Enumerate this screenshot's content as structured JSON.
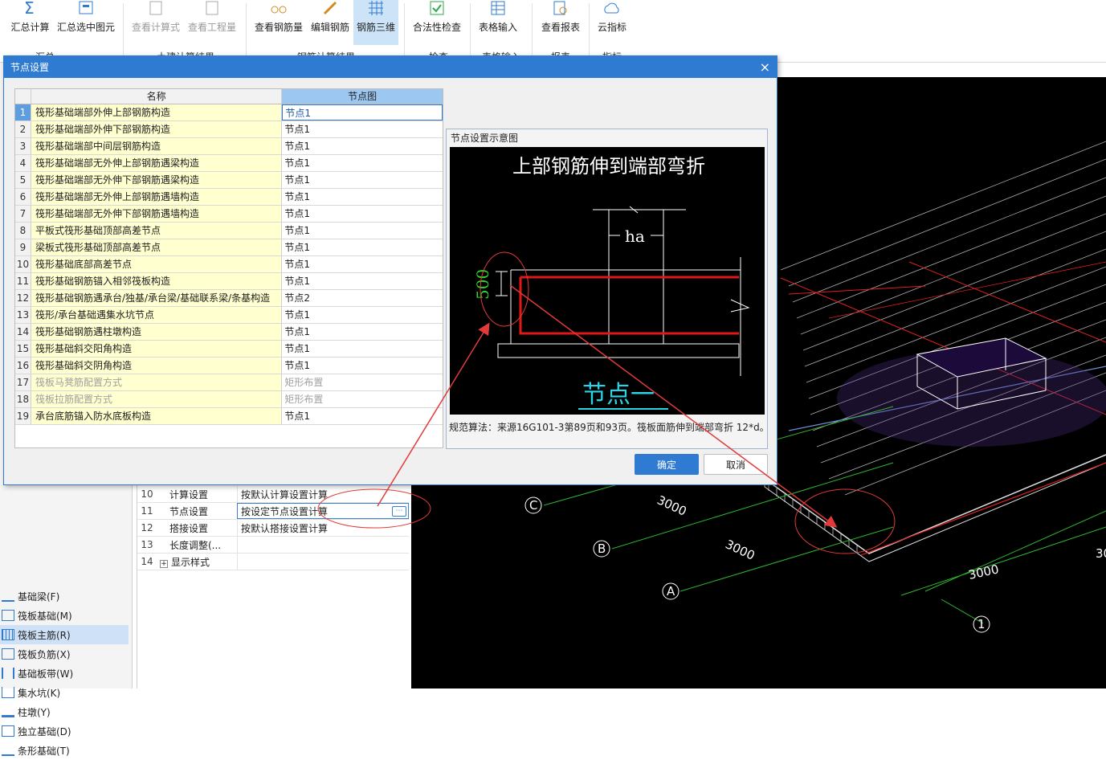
{
  "ribbon": {
    "buttons": [
      {
        "label": "汇总计算",
        "disabled": false
      },
      {
        "label": "汇总选中图元",
        "disabled": false
      },
      {
        "label": "查看计算式",
        "disabled": true
      },
      {
        "label": "查看工程量",
        "disabled": true
      },
      {
        "label": "查看钢筋量",
        "disabled": false
      },
      {
        "label": "编辑钢筋",
        "disabled": false
      },
      {
        "label": "钢筋三维",
        "disabled": false,
        "active": true
      },
      {
        "label": "合法性检查",
        "disabled": false
      },
      {
        "label": "表格输入",
        "disabled": false
      },
      {
        "label": "查看报表",
        "disabled": false
      },
      {
        "label": "云指标",
        "disabled": false
      }
    ],
    "groups": [
      "汇总",
      "土建计算结果",
      "钢筋计算结果",
      "检查",
      "表格输入",
      "报表",
      "指标"
    ]
  },
  "dialog": {
    "title": "节点设置",
    "close": "×",
    "col_name": "名称",
    "col_node": "节点图",
    "rows": [
      {
        "no": "1",
        "name": "筏形基础端部外伸上部钢筋构造",
        "node": "节点1",
        "selected": true
      },
      {
        "no": "2",
        "name": "筏形基础端部外伸下部钢筋构造",
        "node": "节点1"
      },
      {
        "no": "3",
        "name": "筏形基础端部中间层钢筋构造",
        "node": "节点1"
      },
      {
        "no": "4",
        "name": "筏形基础端部无外伸上部钢筋遇梁构造",
        "node": "节点1"
      },
      {
        "no": "5",
        "name": "筏形基础端部无外伸下部钢筋遇梁构造",
        "node": "节点1"
      },
      {
        "no": "6",
        "name": "筏形基础端部无外伸上部钢筋遇墙构造",
        "node": "节点1"
      },
      {
        "no": "7",
        "name": "筏形基础端部无外伸下部钢筋遇墙构造",
        "node": "节点1"
      },
      {
        "no": "8",
        "name": "平板式筏形基础顶部高差节点",
        "node": "节点1"
      },
      {
        "no": "9",
        "name": "梁板式筏形基础顶部高差节点",
        "node": "节点1"
      },
      {
        "no": "10",
        "name": "筏形基础底部高差节点",
        "node": "节点1"
      },
      {
        "no": "11",
        "name": "筏形基础钢筋锚入相邻筏板构造",
        "node": "节点1"
      },
      {
        "no": "12",
        "name": "筏形基础钢筋遇承台/独基/承台梁/基础联系梁/条基构造",
        "node": "节点2"
      },
      {
        "no": "13",
        "name": "筏形/承台基础遇集水坑节点",
        "node": "节点1"
      },
      {
        "no": "14",
        "name": "筏形基础钢筋遇柱墩构造",
        "node": "节点1"
      },
      {
        "no": "15",
        "name": "筏形基础斜交阳角构造",
        "node": "节点1"
      },
      {
        "no": "16",
        "name": "筏形基础斜交阴角构造",
        "node": "节点1"
      },
      {
        "no": "17",
        "name": "筏板马凳筋配置方式",
        "node": "矩形布置",
        "disabled": true
      },
      {
        "no": "18",
        "name": "筏板拉筋配置方式",
        "node": "矩形布置",
        "disabled": true
      },
      {
        "no": "19",
        "name": "承台底筋锚入防水底板构造",
        "node": "节点1"
      }
    ],
    "preview_title": "节点设置示意图",
    "diagram": {
      "heading": "上部钢筋伸到端部弯折",
      "ha": "ha",
      "dim": "500",
      "node_label": "节点一"
    },
    "preview_desc": "规范算法：来源16G101-3第89页和93页。筏板面筋伸到端部弯折 12*d。",
    "ok": "确定",
    "cancel": "取消"
  },
  "left_tree": [
    {
      "label": "基础梁(F)"
    },
    {
      "label": "筏板基础(M)"
    },
    {
      "label": "筏板主筋(R)",
      "selected": true
    },
    {
      "label": "筏板负筋(X)"
    },
    {
      "label": "基础板带(W)"
    },
    {
      "label": "集水坑(K)"
    },
    {
      "label": "柱墩(Y)"
    },
    {
      "label": "独立基础(D)"
    },
    {
      "label": "条形基础(T)"
    }
  ],
  "props": [
    {
      "no": "10",
      "name": "计算设置",
      "value": "按默认计算设置计算"
    },
    {
      "no": "11",
      "name": "节点设置",
      "value": "按设定节点设置计算",
      "selected": true
    },
    {
      "no": "12",
      "name": "搭接设置",
      "value": "按默认搭接设置计算"
    },
    {
      "no": "13",
      "name": "长度调整(...",
      "value": ""
    },
    {
      "no": "14",
      "name": "显示样式",
      "value": "",
      "expand": "+"
    }
  ],
  "view3d": {
    "axis_labels": [
      "C",
      "B",
      "A",
      "1"
    ],
    "dims": [
      "3000",
      "3000",
      "3000",
      "30"
    ]
  },
  "colors": {
    "accent": "#2f7bd1",
    "highlight_yellow": "#ffffd0",
    "annotation_red": "#e23a3a",
    "grid_green": "#2fb52f"
  }
}
